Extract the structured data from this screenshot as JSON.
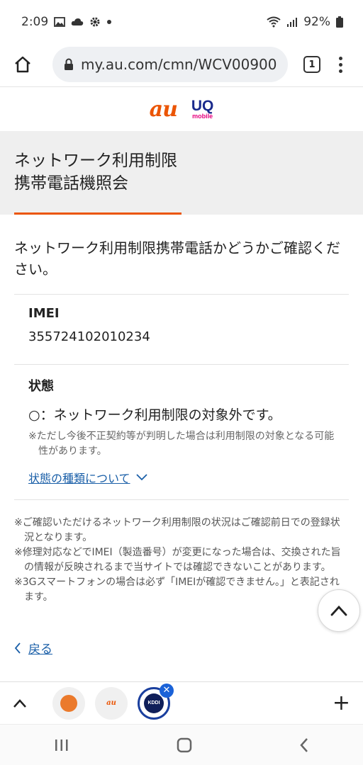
{
  "status_bar": {
    "time": "2:09",
    "battery": "92%"
  },
  "browser": {
    "url": "my.au.com/cmn/WCV00900:",
    "tab_count": "1"
  },
  "logos": {
    "au": "au",
    "uq": "UQ",
    "uq_sub": "mobile"
  },
  "page": {
    "title_line1": "ネットワーク利用制限",
    "title_line2": "携帯電話機照会",
    "intro": "ネットワーク利用制限携帯電話かどうかご確認ください。",
    "imei_label": "IMEI",
    "imei_value": "355724102010234",
    "status_label": "状態",
    "status_value": "○：ネットワーク利用制限の対象外です。",
    "status_note": "※ただし今後不正契約等が判明した場合は利用制限の対象となる可能性があります。",
    "status_link": "状態の種類について",
    "notes": [
      "※ご確認いただけるネットワーク利用制限の状況はご確認前日での登録状況となります。",
      "※修理対応などでIMEI（製造番号）が変更になった場合は、交換された旨の情報が反映されるまで当サイトでは確認できないことがあります。",
      "※3Gスマートフォンの場合は必ず「IMEIが確認できません。」と表記されます。"
    ],
    "back_label": "戻る"
  },
  "tabs": {
    "kddi_label": "KDDI",
    "au_label": "au"
  }
}
